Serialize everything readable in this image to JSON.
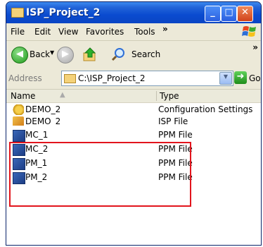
{
  "window": {
    "title": "ISP_Project_2"
  },
  "title_buttons": {
    "minimize": "_",
    "maximize": "□",
    "close": "✕"
  },
  "menu": [
    "File",
    "Edit",
    "View",
    "Favorites",
    "Tools"
  ],
  "menu_more": "»",
  "toolbar": {
    "back_label": "Back",
    "search_label": "Search",
    "more": "»"
  },
  "address": {
    "label": "Address",
    "path": "C:\\ISP_Project_2",
    "go_label": "Go"
  },
  "columns": {
    "name": "Name",
    "type": "Type"
  },
  "files": [
    {
      "name": "DEMO_2",
      "type": "Configuration Settings",
      "icon": "config-file-icon"
    },
    {
      "name": "DEMO_2",
      "type": "ISP File",
      "icon": "isp-file-icon"
    },
    {
      "name": "MC_1",
      "type": "PPM File",
      "icon": "ppm-file-icon"
    },
    {
      "name": "MC_2",
      "type": "PPM File",
      "icon": "ppm-file-icon"
    },
    {
      "name": "PM_1",
      "type": "PPM File",
      "icon": "ppm-file-icon"
    },
    {
      "name": "PM_2",
      "type": "PPM File",
      "icon": "ppm-file-icon"
    }
  ],
  "colors": {
    "titlebar": "#0a4bd0",
    "highlight": "#e2151d"
  }
}
